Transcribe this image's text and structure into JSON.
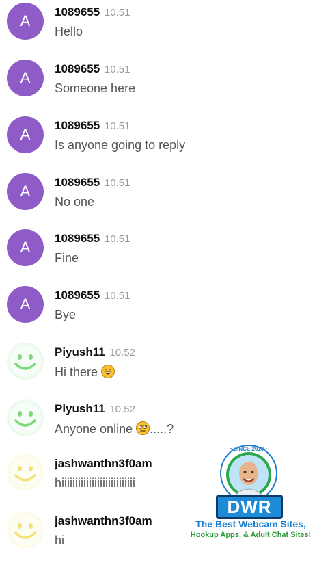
{
  "messages": [
    {
      "avatar": {
        "type": "letter",
        "letter": "A"
      },
      "user": "1089655",
      "time": "10.51",
      "text": "Hello"
    },
    {
      "avatar": {
        "type": "letter",
        "letter": "A"
      },
      "user": "1089655",
      "time": "10.51",
      "text": "Someone here"
    },
    {
      "avatar": {
        "type": "letter",
        "letter": "A"
      },
      "user": "1089655",
      "time": "10.51",
      "text": "Is anyone going to reply"
    },
    {
      "avatar": {
        "type": "letter",
        "letter": "A"
      },
      "user": "1089655",
      "time": "10.51",
      "text": "No one"
    },
    {
      "avatar": {
        "type": "letter",
        "letter": "A"
      },
      "user": "1089655",
      "time": "10.51",
      "text": "Fine"
    },
    {
      "avatar": {
        "type": "letter",
        "letter": "A"
      },
      "user": "1089655",
      "time": "10.51",
      "text": "Bye"
    },
    {
      "avatar": {
        "type": "smiley-green"
      },
      "user": "Piyush11",
      "time": "10.52",
      "text": "Hi there",
      "emoji": "grinning-face-emoji"
    },
    {
      "avatar": {
        "type": "smiley-green"
      },
      "user": "Piyush11",
      "time": "10.52",
      "text": "Anyone online",
      "emoji": "eye-roll-face-emoji",
      "suffix": ".....?"
    },
    {
      "avatar": {
        "type": "smiley-yellow"
      },
      "user": "jashwanthn3f0am",
      "time": "",
      "text": "hiiiiiiiiiiiiiiiiiiiiiiiiiii"
    },
    {
      "avatar": {
        "type": "smiley-yellow"
      },
      "user": "jashwanthn3f0am",
      "time": "",
      "text": "hi"
    }
  ],
  "watermark": {
    "since": "• SINCE 2010 •",
    "brand": "DWR",
    "tagline_1": "The Best Webcam Sites,",
    "tagline_2": "Hookup Apps, & Adult Chat Sites!"
  },
  "colors": {
    "letter_avatar": "#8e5bc7",
    "green_smiley": "#7bd87b",
    "yellow_smiley": "#f2e27a",
    "brand_blue": "#1d8bd6",
    "brand_green": "#2a9a3a"
  }
}
